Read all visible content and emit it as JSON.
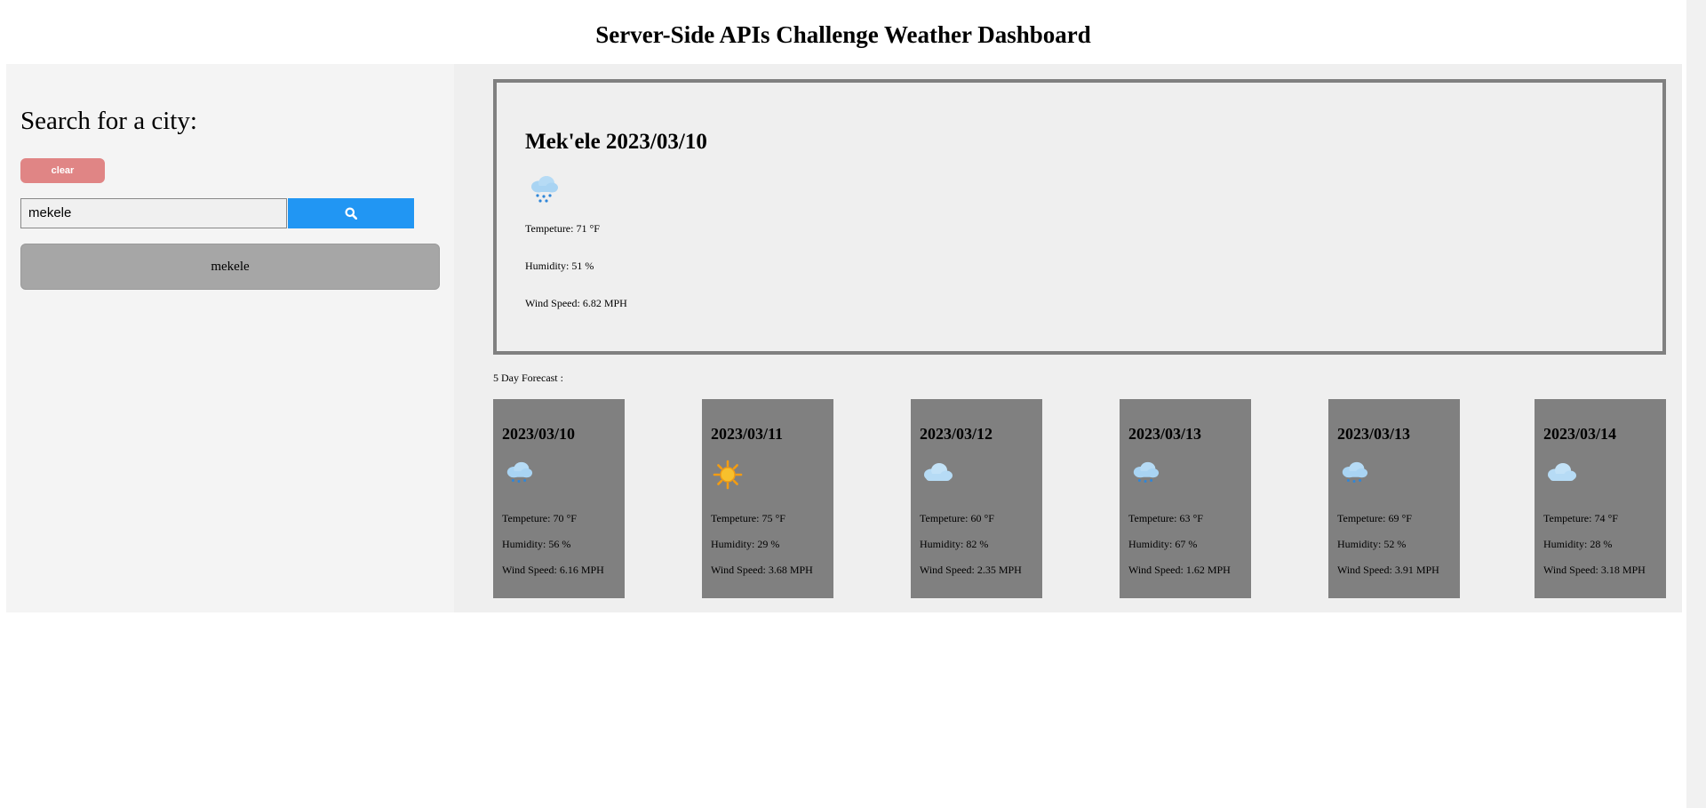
{
  "header": {
    "title": "Server-Side APIs Challenge Weather Dashboard"
  },
  "sidebar": {
    "heading": "Search for a city:",
    "clear_label": "clear",
    "search_value": "mekele",
    "search_icon": "search-icon",
    "history": [
      "mekele"
    ]
  },
  "current": {
    "title": "Mek'ele 2023/03/10",
    "icon": "rain-cloud-icon",
    "temperature": "Tempeture: 71 °F",
    "humidity": "Humidity: 51 %",
    "wind": "Wind Speed: 6.82 MPH"
  },
  "forecast": {
    "label": "5 Day Forecast :",
    "days": [
      {
        "date": "2023/03/10",
        "icon": "rain-cloud-icon",
        "temperature": "Tempeture: 70 °F",
        "humidity": "Humidity: 56 %",
        "wind": "Wind Speed: 6.16 MPH"
      },
      {
        "date": "2023/03/11",
        "icon": "sun-icon",
        "temperature": "Tempeture: 75 °F",
        "humidity": "Humidity: 29 %",
        "wind": "Wind Speed: 3.68 MPH"
      },
      {
        "date": "2023/03/12",
        "icon": "cloud-icon",
        "temperature": "Tempeture: 60 °F",
        "humidity": "Humidity: 82 %",
        "wind": "Wind Speed: 2.35 MPH"
      },
      {
        "date": "2023/03/13",
        "icon": "rain-cloud-icon",
        "temperature": "Tempeture: 63 °F",
        "humidity": "Humidity: 67 %",
        "wind": "Wind Speed: 1.62 MPH"
      },
      {
        "date": "2023/03/13",
        "icon": "rain-cloud-icon",
        "temperature": "Tempeture: 69 °F",
        "humidity": "Humidity: 52 %",
        "wind": "Wind Speed: 3.91 MPH"
      },
      {
        "date": "2023/03/14",
        "icon": "cloud-icon",
        "temperature": "Tempeture: 74 °F",
        "humidity": "Humidity: 28 %",
        "wind": "Wind Speed: 3.18 MPH"
      }
    ]
  },
  "colors": {
    "clear_button": "#e08585",
    "search_button": "#2196f3",
    "history_button": "#a6a6a6",
    "forecast_card": "#808080",
    "current_border": "#808080"
  }
}
